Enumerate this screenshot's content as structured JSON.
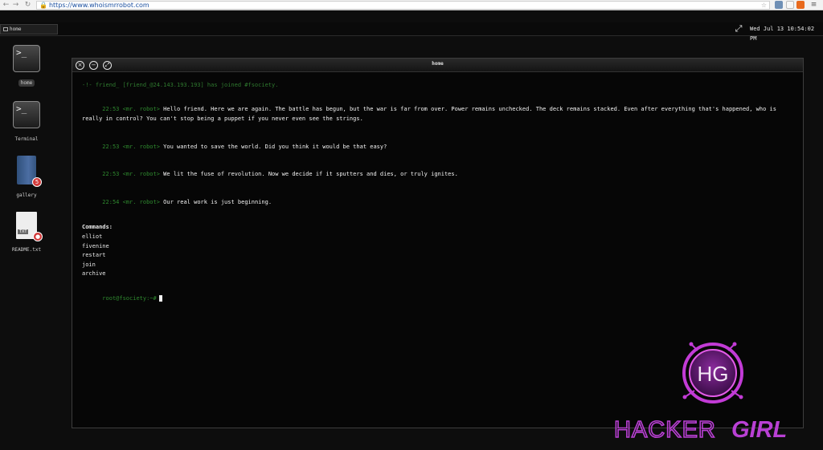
{
  "browser": {
    "url": "https://www.whoismrrobot.com",
    "back_glyph": "←",
    "forward_glyph": "→",
    "reload_glyph": "↻",
    "menu_glyph": "≡",
    "star_glyph": "☆"
  },
  "os_bar": {
    "window_tab_label": "home",
    "clock": "Wed Jul 13 10:54:02 PM",
    "fullscreen_glyph": "⤢"
  },
  "desktop": {
    "icons": [
      {
        "label": "home",
        "glyph": ">_"
      },
      {
        "label": "Terminal",
        "glyph": ">_"
      },
      {
        "label": "gallery",
        "badge": "5"
      },
      {
        "label": "README.txt",
        "ext": "TXT",
        "badge": "●"
      }
    ]
  },
  "window": {
    "title": "home",
    "close_glyph": "×",
    "minimize_glyph": "−",
    "maximize_glyph": "⤢"
  },
  "terminal": {
    "join_line": "-!- friend_ [friend_@24.143.193.193] has joined #fsociety.",
    "messages": [
      {
        "ts": "22:53",
        "nick": "<mr. robot>",
        "text": "Hello friend. Here we are again. The battle has begun, but the war is far from over. Power remains unchecked. The deck remains stacked. Even after everything that's happened, who is really in control? You can't stop being a puppet if you never even see the strings."
      },
      {
        "ts": "22:53",
        "nick": "<mr. robot>",
        "text": "You wanted to save the world. Did you think it would be that easy?"
      },
      {
        "ts": "22:53",
        "nick": "<mr. robot>",
        "text": "We lit the fuse of revolution. Now we decide if it sputters and dies, or truly ignites."
      },
      {
        "ts": "22:54",
        "nick": "<mr. robot>",
        "text": "Our real work is just beginning."
      }
    ],
    "commands_header": "Commands:",
    "commands": [
      "elliot",
      "fivenine",
      "restart",
      "join",
      "archive"
    ],
    "prompt": "root@fsociety:~#"
  },
  "watermark": {
    "logo_text": "HG",
    "brand_part1": "HACKER",
    "brand_part2": "GIRL"
  },
  "colors": {
    "terminal_green": "#2f8a2f",
    "watermark_pink": "#c23bd6",
    "brand_text": "#b940d4"
  }
}
